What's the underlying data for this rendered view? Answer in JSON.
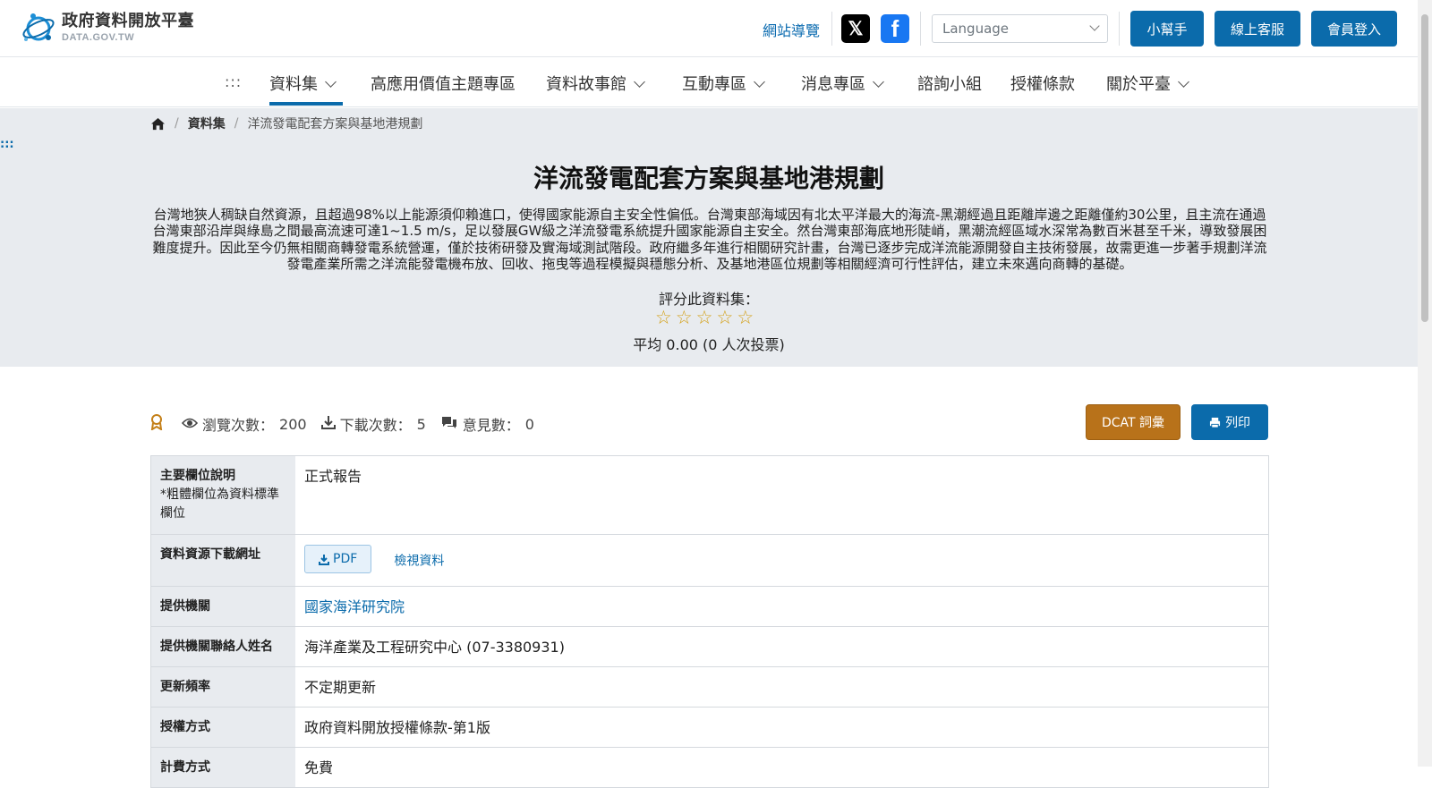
{
  "header": {
    "logo_title": "政府資料開放平臺",
    "logo_subtitle": "DATA.GOV.TW",
    "sitemap": "網站導覽",
    "language_placeholder": "Language",
    "buttons": {
      "helper": "小幫手",
      "support": "線上客服",
      "login": "會員登入"
    }
  },
  "nav": {
    "dots": ":::",
    "items": [
      "資料集",
      "高應用價值主題專區",
      "資料故事館",
      "互動專區",
      "消息專區",
      "諮詢小組",
      "授權條款",
      "關於平臺"
    ]
  },
  "breadcrumb": {
    "level1": "資料集",
    "current": "洋流發電配套方案與基地港規劃"
  },
  "side_dots": ":::",
  "dataset": {
    "title": "洋流發電配套方案與基地港規劃",
    "description": "台灣地狹人稠缺自然資源，且超過98%以上能源須仰賴進口，使得國家能源自主安全性偏低。台灣東部海域因有北太平洋最大的海流-黑潮經過且距離岸邊之距離僅約30公里，且主流在通過台灣東部沿岸與綠島之間最高流速可達1~1.5 m/s，足以發展GW級之洋流發電系統提升國家能源自主安全。然台灣東部海底地形陡峭，黑潮流經區域水深常為數百米甚至千米，導致發展困難度提升。因此至今仍無相關商轉發電系統營運，僅於技術研發及實海域測試階段。政府繼多年進行相關研究計畫，台灣已逐步完成洋流能源開發自主技術發展，故需更進一步著手規劃洋流發電產業所需之洋流能發電機布放、回收、拖曳等過程模擬與穩態分析、及基地港區位規劃等相關經濟可行性評估，建立未來邁向商轉的基礎。",
    "rating_label": "評分此資料集：",
    "rating_stars": 0,
    "rating_summary": "平均 0.00 (0 人次投票)"
  },
  "stats": {
    "views_label": "瀏覽次數：",
    "views": "200",
    "downloads_label": "下載次數：",
    "downloads": "5",
    "comments_label": "意見數：",
    "comments": "0"
  },
  "actions": {
    "dcat": "DCAT 詞彙",
    "print": "列印"
  },
  "table": {
    "rows": [
      {
        "label": "主要欄位說明",
        "note": "*粗體欄位為資料標準欄位",
        "value": "正式報告"
      },
      {
        "label": "資料資源下載網址",
        "pdf": "PDF",
        "view": "檢視資料"
      },
      {
        "label": "提供機關",
        "value": "國家海洋研究院"
      },
      {
        "label": "提供機關聯絡人姓名",
        "value": "海洋產業及工程研究中心 (07-3380931)"
      },
      {
        "label": "更新頻率",
        "value": "不定期更新"
      },
      {
        "label": "授權方式",
        "value": "政府資料開放授權條款-第1版"
      },
      {
        "label": "計費方式",
        "value": "免費"
      }
    ]
  },
  "colors": {
    "primary": "#0b6bab",
    "dcat": "#b8721a",
    "hero_bg": "#e8ebef",
    "star": "#d4a017"
  }
}
